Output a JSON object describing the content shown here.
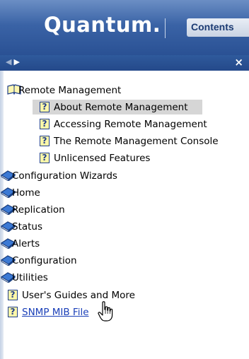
{
  "header": {
    "logo_text": "Quantum.",
    "tab_label": "Contents"
  },
  "toolbar": {
    "nav_back_icon": "left-triangle-icon",
    "nav_forward_icon": "right-triangle-icon",
    "close_label": "×"
  },
  "tree": {
    "root_open": {
      "label": "Remote Management",
      "icon": "open-book-icon"
    },
    "children": [
      {
        "label": "About Remote Management",
        "icon": "question-page-icon",
        "selected": true
      },
      {
        "label": "Accessing Remote Management",
        "icon": "question-page-icon"
      },
      {
        "label": "The Remote Management Console",
        "icon": "question-page-icon"
      },
      {
        "label": "Unlicensed Features",
        "icon": "question-page-icon"
      }
    ],
    "books": [
      {
        "label": "Configuration Wizards",
        "icon": "closed-book-icon"
      },
      {
        "label": "Home",
        "icon": "closed-book-icon"
      },
      {
        "label": "Replication",
        "icon": "closed-book-icon"
      },
      {
        "label": "Status",
        "icon": "closed-book-icon"
      },
      {
        "label": "Alerts",
        "icon": "closed-book-icon"
      },
      {
        "label": "Configuration",
        "icon": "closed-book-icon"
      },
      {
        "label": "Utilities",
        "icon": "closed-book-icon"
      }
    ],
    "pages": [
      {
        "label": "User's Guides and More",
        "icon": "question-page-icon"
      },
      {
        "label": "SNMP MIB File",
        "icon": "question-page-icon",
        "hovered": true
      }
    ]
  },
  "colors": {
    "header": "#3a63a6",
    "strip": "#24498a",
    "selected": "#d6d6d6",
    "link": "#1a3fb8"
  }
}
